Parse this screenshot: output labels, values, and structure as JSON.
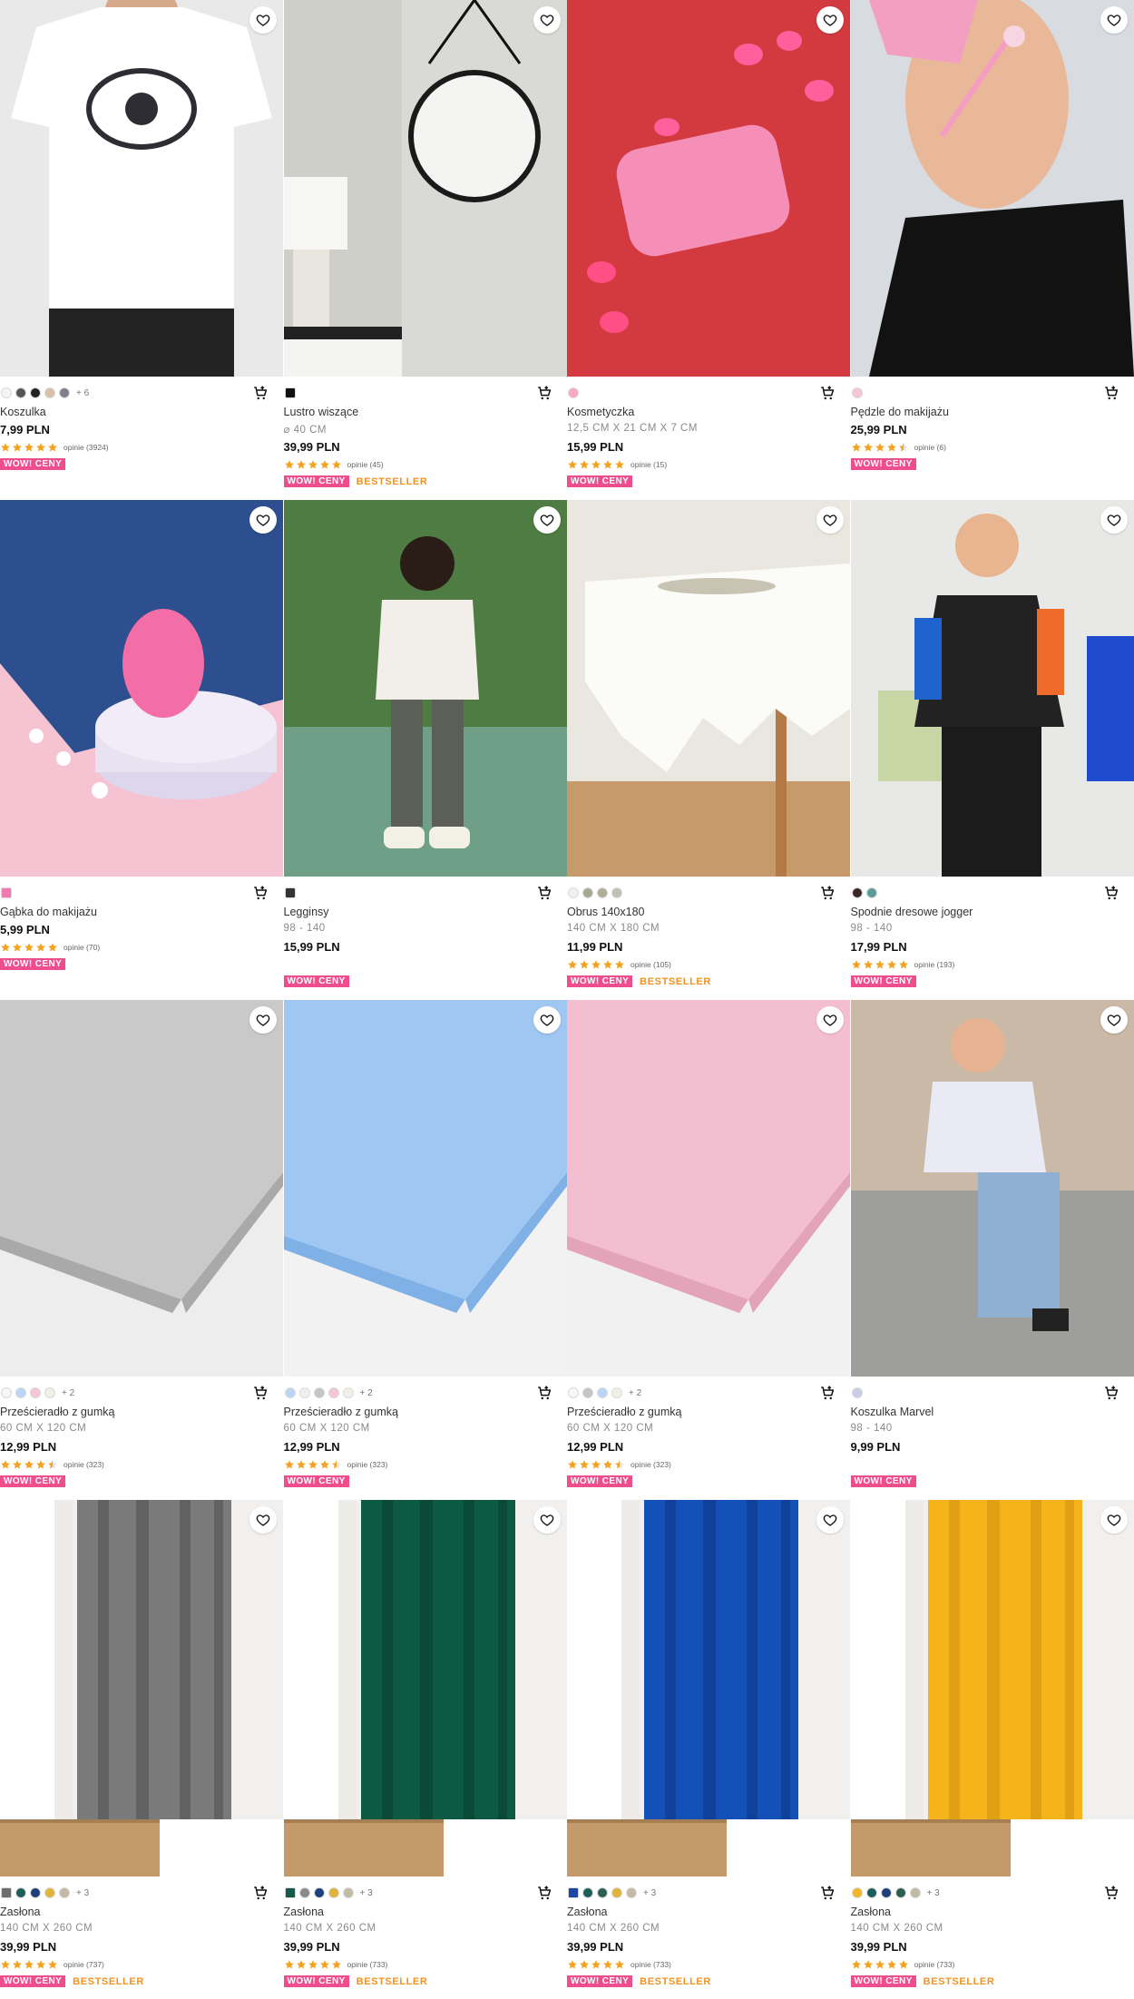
{
  "rating_labels": {
    "prefix": "opinie"
  },
  "tags": {
    "wow": "WOW! CENY",
    "bestseller": "BESTSELLER"
  },
  "products": [
    {
      "name": "Koszulka",
      "size": "",
      "price": "7,99 PLN",
      "reviews": "opinie (3924)",
      "rating": 5,
      "colors": [
        "#f4f4f4",
        "#555555",
        "#222222",
        "#d7c1a8",
        "#7d8088"
      ],
      "more": "+ 6",
      "wow": true,
      "bestseller": false,
      "image": "tshirt-white"
    },
    {
      "name": "Lustro wiszące",
      "size": "⌀ 40 CM",
      "price": "39,99 PLN",
      "reviews": "opinie (45)",
      "rating": 5,
      "colors": [
        "#111111"
      ],
      "swatch_square": true,
      "more": "",
      "wow": true,
      "bestseller": true,
      "image": "mirror"
    },
    {
      "name": "Kosmetyczka",
      "size": "12,5 CM X 21 CM X 7 CM",
      "price": "15,99 PLN",
      "reviews": "opinie (15)",
      "rating": 5,
      "colors": [
        "#f7a8c4"
      ],
      "more": "",
      "wow": true,
      "bestseller": false,
      "image": "cosmetic-bag"
    },
    {
      "name": "Pędzle do makijażu",
      "size": "",
      "price": "25,99 PLN",
      "reviews": "opinie (6)",
      "rating": 4.5,
      "colors": [
        "#f6c5d9"
      ],
      "more": "",
      "wow": true,
      "bestseller": false,
      "image": "makeup-brush"
    },
    {
      "name": "Gąbka do makijażu",
      "size": "",
      "price": "5,99 PLN",
      "reviews": "opinie (70)",
      "rating": 5,
      "colors": [
        "#f27ab0"
      ],
      "swatch_square": true,
      "more": "",
      "wow": true,
      "bestseller": false,
      "image": "sponge"
    },
    {
      "name": "Legginsy",
      "size": "98 - 140",
      "price": "15,99 PLN",
      "reviews": "",
      "rating": 0,
      "colors": [
        "#333333"
      ],
      "swatch_square": true,
      "more": "",
      "wow": true,
      "bestseller": false,
      "image": "leggings"
    },
    {
      "name": "Obrus 140x180",
      "size": "140 CM X 180 CM",
      "price": "11,99 PLN",
      "reviews": "opinie (105)",
      "rating": 5,
      "colors": [
        "#f2f2ee",
        "#a9a892",
        "#b0ad98",
        "#c2c0b6"
      ],
      "more": "",
      "wow": true,
      "bestseller": true,
      "image": "tablecloth"
    },
    {
      "name": "Spodnie dresowe jogger",
      "size": "98 - 140",
      "price": "17,99 PLN",
      "reviews": "opinie (193)",
      "rating": 5,
      "colors": [
        "#3a2626",
        "#5a9a9b"
      ],
      "more": "",
      "wow": true,
      "bestseller": false,
      "image": "jogger-boy"
    },
    {
      "name": "Prześcieradło z gumką",
      "size": "60 CM X 120 CM",
      "price": "12,99 PLN",
      "reviews": "opinie (323)",
      "rating": 4.5,
      "colors": [
        "#f7f7f7",
        "#b9d6f5",
        "#f5c7d6",
        "#f2f0e6"
      ],
      "more": "+ 2",
      "wow": true,
      "bestseller": false,
      "image": "sheet-grey"
    },
    {
      "name": "Prześcieradło z gumką",
      "size": "60 CM X 120 CM",
      "price": "12,99 PLN",
      "reviews": "opinie (323)",
      "rating": 4.5,
      "colors": [
        "#b9d6f5",
        "#efefef",
        "#c4c4c4",
        "#f5c7d6",
        "#f2f0e6"
      ],
      "more": "+ 2",
      "wow": true,
      "bestseller": false,
      "image": "sheet-blue"
    },
    {
      "name": "Prześcieradło z gumką",
      "size": "60 CM X 120 CM",
      "price": "12,99 PLN",
      "reviews": "opinie (323)",
      "rating": 4.5,
      "colors": [
        "#f7f7f7",
        "#c4c4c4",
        "#b9d6f5",
        "#f2f0e6"
      ],
      "more": "+ 2",
      "wow": true,
      "bestseller": false,
      "image": "sheet-pink"
    },
    {
      "name": "Koszulka Marvel",
      "size": "98 - 140",
      "price": "9,99 PLN",
      "reviews": "",
      "rating": 0,
      "colors": [
        "#c7cde8"
      ],
      "more": "",
      "wow": true,
      "bestseller": false,
      "image": "marvel-boy"
    },
    {
      "name": "Zasłona",
      "size": "140 CM X 260 CM",
      "price": "39,99 PLN",
      "reviews": "opinie (737)",
      "rating": 5,
      "colors": [
        "#6d6d6d",
        "#1b5f5a",
        "#1d3f7a",
        "#e1b33c",
        "#c2b9a7"
      ],
      "swatch_first_square": true,
      "more": "+ 3",
      "wow": true,
      "bestseller": true,
      "image": "curtain-grey"
    },
    {
      "name": "Zasłona",
      "size": "140 CM X 260 CM",
      "price": "39,99 PLN",
      "reviews": "opinie (733)",
      "rating": 5,
      "colors": [
        "#16584c",
        "#8a8a8a",
        "#1d3f7a",
        "#e1b33c",
        "#c2b9a7"
      ],
      "swatch_first_square": true,
      "more": "+ 3",
      "wow": true,
      "bestseller": true,
      "image": "curtain-green"
    },
    {
      "name": "Zasłona",
      "size": "140 CM X 260 CM",
      "price": "39,99 PLN",
      "reviews": "opinie (733)",
      "rating": 5,
      "colors": [
        "#1b47a6",
        "#1b5f5a",
        "#2c5e52",
        "#e1b33c",
        "#c2b9a7"
      ],
      "swatch_first_square": true,
      "more": "+ 3",
      "wow": true,
      "bestseller": true,
      "image": "curtain-blue"
    },
    {
      "name": "Zasłona",
      "size": "140 CM X 260 CM",
      "price": "39,99 PLN",
      "reviews": "opinie (733)",
      "rating": 5,
      "colors": [
        "#f1b726",
        "#1b5f5a",
        "#1d3f7a",
        "#2c5e52",
        "#c2b9a7"
      ],
      "more": "+ 3",
      "wow": true,
      "bestseller": true,
      "image": "curtain-yellow"
    }
  ]
}
